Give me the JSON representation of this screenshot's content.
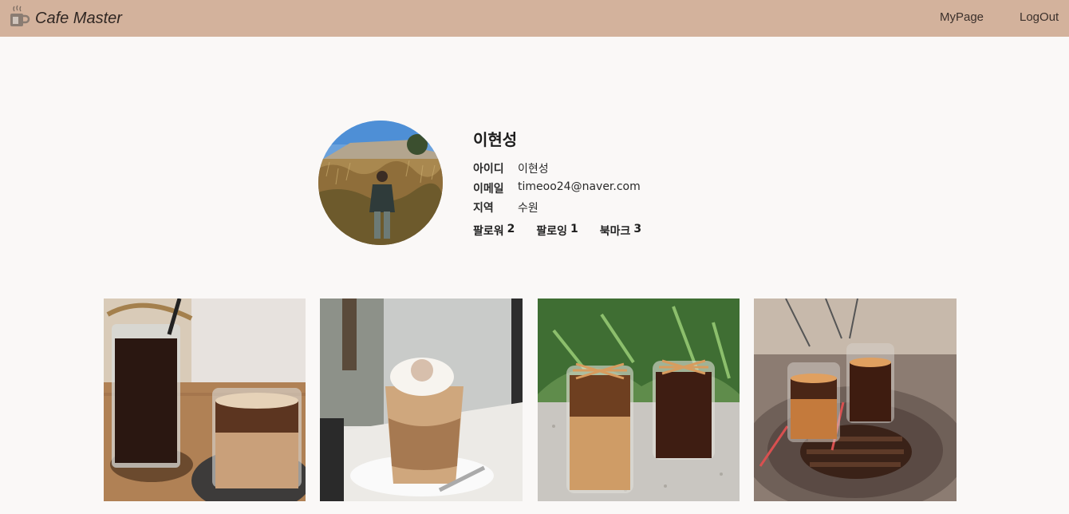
{
  "app": {
    "title": "Cafe Master",
    "logo_icon": "coffee-cup-icon"
  },
  "nav": {
    "mypage_label": "MyPage",
    "logout_label": "LogOut"
  },
  "profile": {
    "name": "이현성",
    "fields": [
      {
        "key": "아이디",
        "value": "이현성"
      },
      {
        "key": "이메일",
        "value": "timeoo24@naver.com"
      },
      {
        "key": "지역",
        "value": "수원"
      }
    ],
    "stats": [
      {
        "label": "팔로워",
        "count": "2"
      },
      {
        "label": "팔로잉",
        "count": "1"
      },
      {
        "label": "북마크",
        "count": "3"
      }
    ]
  },
  "posts": [
    {
      "subject": "iced americano and dirty latte on a wooden table"
    },
    {
      "subject": "iced latte with cream by a window"
    },
    {
      "subject": "two iced coffees on a gravel ledge"
    },
    {
      "subject": "two iced coffees on a glass table"
    }
  ],
  "colors": {
    "navbar": "#d3b29c",
    "background": "#faf8f7"
  }
}
